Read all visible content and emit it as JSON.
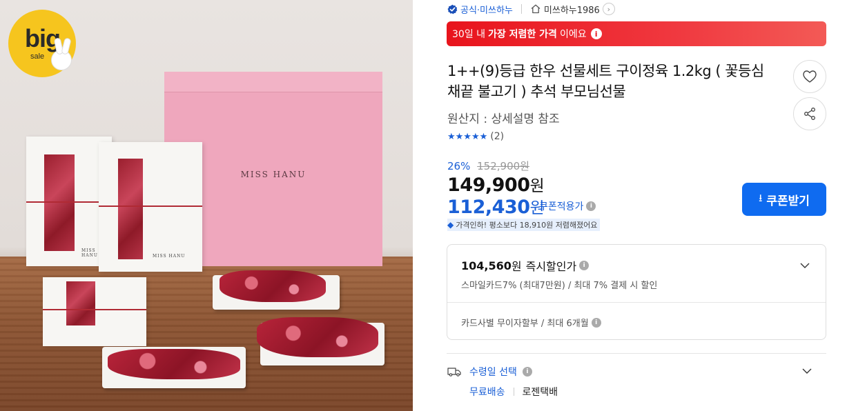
{
  "image": {
    "badge_word": "big",
    "badge_sub": "sale",
    "box_label": "MISS HANU",
    "bag_label": "MISS HANU"
  },
  "seller": {
    "official_label": "공식·미쓰하누",
    "store_name": "미쓰하누1986"
  },
  "banner": {
    "prefix": "30일 내 ",
    "highlight": "가장 저렴한 가격",
    "suffix": "이에요"
  },
  "product": {
    "title": "1++(9)등급 한우 선물세트 구이정육 1.2kg ( 꽃등심 채끝 불고기 ) 추석 부모님선물",
    "origin": "원산지 : 상세설명 참조",
    "stars": "★★★★★",
    "review_count": "(2)"
  },
  "price": {
    "discount_rate": "26%",
    "original": "152,900원",
    "sale_number": "149,900",
    "sale_unit": "원",
    "coupon_number": "112,430",
    "coupon_unit": "원",
    "coupon_note": "쿠폰적용가",
    "drop_note": "가격인하! 평소보다 18,910원 저렴해졌어요"
  },
  "coupon_button": {
    "label": "쿠폰받기"
  },
  "card": {
    "instant_number": "104,560",
    "instant_unit": "원",
    "instant_label": "즉시할인가",
    "smile_text": "스마일카드7% (최대7만원) / 최대 7% 결제 시 할인",
    "install_text": "카드사별 무이자할부 / 최대 6개월"
  },
  "delivery": {
    "label": "수령일 선택",
    "free": "무료배송",
    "courier": "로젠택배"
  },
  "colors": {
    "accent_blue": "#1a5fd6",
    "button_blue": "#0f6bf0",
    "banner_red": "#e8141c",
    "badge_yellow": "#f6c51e"
  }
}
